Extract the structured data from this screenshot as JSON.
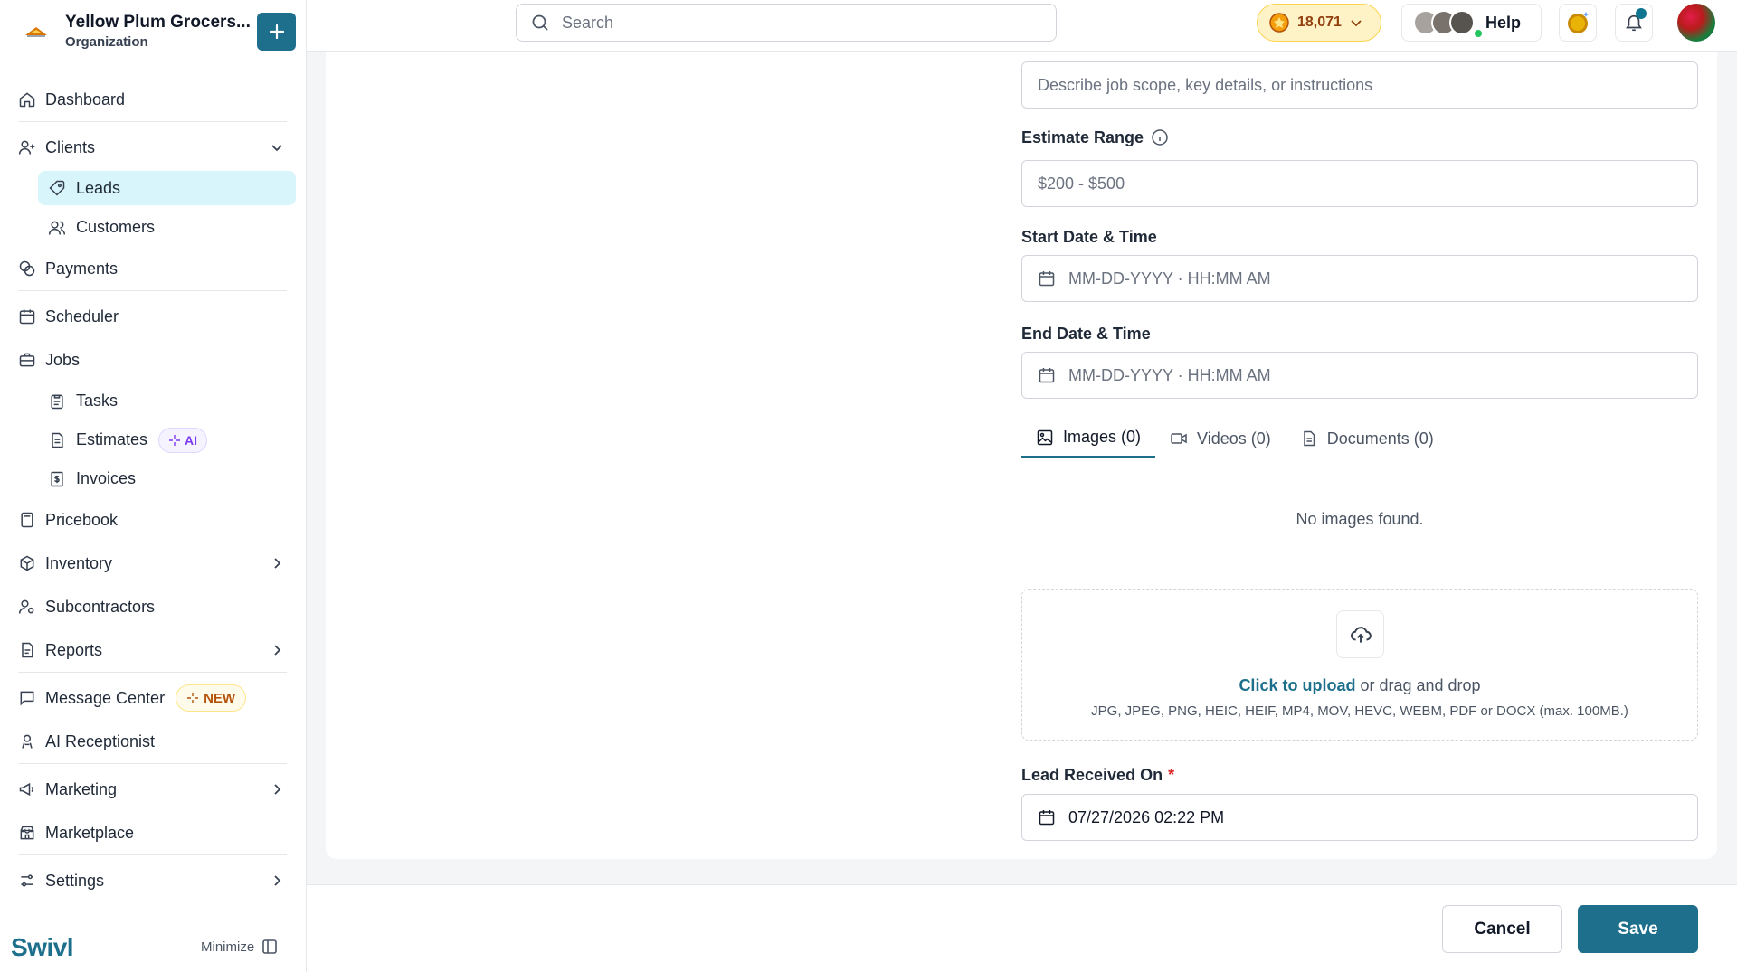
{
  "org": {
    "name": "Yellow Plum Grocers...",
    "type": "Organization"
  },
  "nav": {
    "dashboard": "Dashboard",
    "clients": "Clients",
    "leads": "Leads",
    "customers": "Customers",
    "payments": "Payments",
    "scheduler": "Scheduler",
    "jobs": "Jobs",
    "tasks": "Tasks",
    "estimates": "Estimates",
    "estimates_badge": "AI",
    "invoices": "Invoices",
    "pricebook": "Pricebook",
    "inventory": "Inventory",
    "subcontractors": "Subcontractors",
    "reports": "Reports",
    "message_center": "Message Center",
    "message_center_badge": "NEW",
    "ai_receptionist": "AI Receptionist",
    "marketing": "Marketing",
    "marketplace": "Marketplace",
    "settings": "Settings"
  },
  "brand": "Swivl",
  "minimize_label": "Minimize",
  "search": {
    "placeholder": "Search"
  },
  "topbar": {
    "coins": "18,071",
    "help_label": "Help"
  },
  "form": {
    "description": {
      "placeholder": "Describe job scope, key details, or instructions"
    },
    "estimate_range": {
      "label": "Estimate Range",
      "placeholder": "$200 - $500"
    },
    "start_date": {
      "label": "Start Date & Time",
      "placeholder": "MM-DD-YYYY · HH:MM AM"
    },
    "end_date": {
      "label": "End Date & Time",
      "placeholder": "MM-DD-YYYY · HH:MM AM"
    },
    "tabs": [
      "Images (0)",
      "Videos (0)",
      "Documents (0)"
    ],
    "empty_message": "No images found.",
    "upload": {
      "link": "Click to upload",
      "rest": " or drag and drop",
      "formats": "JPG, JPEG, PNG, HEIC, HEIF, MP4, MOV, HEVC, WEBM, PDF or DOCX (max. 100MB.)"
    },
    "lead_received": {
      "label": "Lead Received On",
      "required_mark": "*",
      "value": "07/27/2026 02:22 PM"
    }
  },
  "footer": {
    "cancel": "Cancel",
    "save": "Save"
  },
  "colors": {
    "primary": "#1d6f8c",
    "active_nav_bg": "#d7f5fb",
    "ai_badge": "#7c3aed",
    "new_badge": "#b45309"
  }
}
